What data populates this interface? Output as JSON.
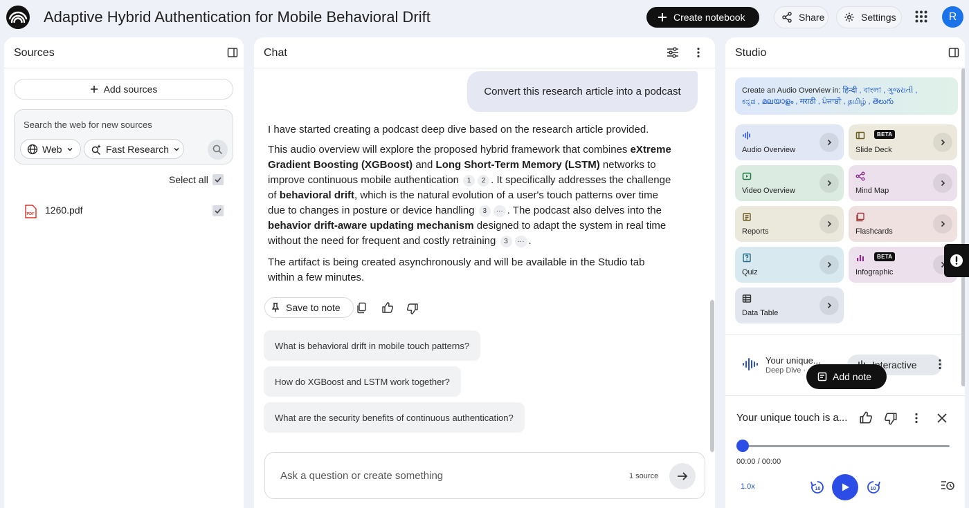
{
  "header": {
    "title": "Adaptive Hybrid Authentication for Mobile Behavioral Drift",
    "create_notebook": "Create notebook",
    "share": "Share",
    "settings": "Settings",
    "avatar_initial": "R"
  },
  "sources": {
    "title": "Sources",
    "add_sources": "Add sources",
    "search_placeholder": "Search the web for new sources",
    "web_chip": "Web",
    "research_chip": "Fast Research",
    "select_all": "Select all",
    "items": [
      {
        "name": "1260.pdf",
        "type_badge": "PDF",
        "checked": true
      }
    ]
  },
  "chat": {
    "title": "Chat",
    "user_message": "Convert this research article into a podcast",
    "response": {
      "p1": "I have started creating a podcast deep dive based on the research article provided.",
      "p2": [
        {
          "t": "This audio overview will explore the proposed hybrid framework that combines "
        },
        {
          "b": "eXtreme Gradient Boosting (XGBoost)"
        },
        {
          "t": " and "
        },
        {
          "b": "Long Short-Term Memory (LSTM)"
        },
        {
          "t": " networks to improve continuous mobile authentication "
        },
        {
          "c": "1"
        },
        {
          "c": "2"
        },
        {
          "t": ". It specifically addresses the challenge of "
        },
        {
          "b": "behavioral drift"
        },
        {
          "t": ", which is the natural evolution of a user's touch patterns over time due to changes in posture or device handling "
        },
        {
          "c": "3"
        },
        {
          "c": "···"
        },
        {
          "t": ". The podcast also delves into the "
        },
        {
          "b": "behavior drift-aware updating mechanism"
        },
        {
          "t": " designed to adapt the system in real time without the need for frequent and costly retraining "
        },
        {
          "c": "3"
        },
        {
          "c": "···"
        },
        {
          "t": "."
        }
      ],
      "p3": "The artifact is being created asynchronously and will be available in the Studio tab within a few minutes."
    },
    "save_to_note": "Save to note",
    "suggestions": [
      "What is behavioral drift in mobile touch patterns?",
      "How do XGBoost and LSTM work together?",
      "What are the security benefits of continuous authentication?"
    ],
    "input_placeholder": "Ask a question or create something",
    "source_count": "1 source"
  },
  "studio": {
    "title": "Studio",
    "lang_label": "Create an Audio Overview in:",
    "lang_line1": "हिन्दी , বাংলা , ગુજરાતી ,",
    "lang_line2": "ಕನ್ನಡ , മലയാളം , मराठी , ਪੰਜਾਬੀ , தமிழ் , తెలుగు",
    "beta_label": "BETA",
    "tiles": [
      {
        "label": "Audio Overview",
        "color": "#e1e7f5",
        "icon": "waveform-icon"
      },
      {
        "label": "Slide Deck",
        "color": "#ece9dc",
        "icon": "slides-icon",
        "beta": true
      },
      {
        "label": "Video Overview",
        "color": "#dcebe2",
        "icon": "video-icon"
      },
      {
        "label": "Mind Map",
        "color": "#ebe0ec",
        "icon": "mind-map-icon"
      },
      {
        "label": "Reports",
        "color": "#ebe8dc",
        "icon": "reports-icon"
      },
      {
        "label": "Flashcards",
        "color": "#f0e1e1",
        "icon": "flashcards-icon"
      },
      {
        "label": "Quiz",
        "color": "#d9e9f0",
        "icon": "quiz-icon"
      },
      {
        "label": "Infographic",
        "color": "#ebe0ec",
        "icon": "infographic-icon",
        "beta": true
      },
      {
        "label": "Data Table",
        "color": "#e1e6ef",
        "icon": "table-icon"
      }
    ],
    "artifact_title": "Your unique...",
    "artifact_sub": "Deep Dive ·",
    "interactive": "Interactive",
    "player_title": "Your unique touch is a...",
    "time": "00:00 / 00:00",
    "speed": "1.0x",
    "progress": 0
  },
  "floating": {
    "add_note": "Add note"
  }
}
